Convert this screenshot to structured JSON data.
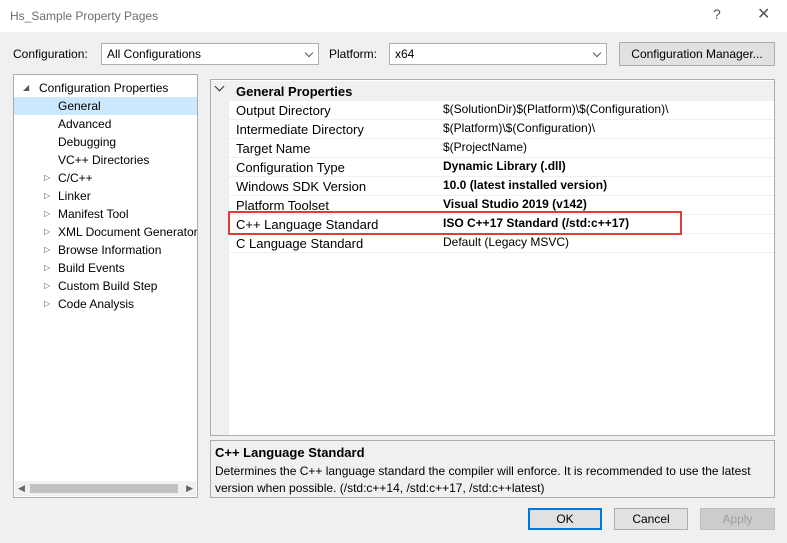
{
  "window": {
    "title": "Hs_Sample Property Pages",
    "help_glyph": "?",
    "close_glyph": "✕"
  },
  "toolbar": {
    "configuration_label": "Configuration:",
    "configuration_value": "All Configurations",
    "platform_label": "Platform:",
    "platform_value": "x64",
    "config_manager_label": "Configuration Manager..."
  },
  "tree": {
    "root_arrow": "◢",
    "collapsed_arrow": "▷",
    "root_label": "Configuration Properties",
    "children": [
      "General",
      "Advanced",
      "Debugging",
      "VC++ Directories"
    ],
    "expandable": [
      "C/C++",
      "Linker",
      "Manifest Tool",
      "XML Document Generator",
      "Browse Information",
      "Build Events",
      "Custom Build Step",
      "Code Analysis"
    ],
    "selected": "General",
    "scroll_left": "◀",
    "scroll_right": "▶"
  },
  "grid": {
    "section_title": "General Properties",
    "properties": [
      {
        "name": "Output Directory",
        "value": "$(SolutionDir)$(Platform)\\$(Configuration)\\",
        "bold": false
      },
      {
        "name": "Intermediate Directory",
        "value": "$(Platform)\\$(Configuration)\\",
        "bold": false
      },
      {
        "name": "Target Name",
        "value": "$(ProjectName)",
        "bold": false
      },
      {
        "name": "Configuration Type",
        "value": "Dynamic Library (.dll)",
        "bold": true
      },
      {
        "name": "Windows SDK Version",
        "value": "10.0 (latest installed version)",
        "bold": true
      },
      {
        "name": "Platform Toolset",
        "value": "Visual Studio 2019 (v142)",
        "bold": true
      },
      {
        "name": "C++ Language Standard",
        "value": "ISO C++17 Standard (/std:c++17)",
        "bold": true
      },
      {
        "name": "C Language Standard",
        "value": "Default (Legacy MSVC)",
        "bold": false
      }
    ],
    "highlight_color": "#e03c3c"
  },
  "description": {
    "title": "C++ Language Standard",
    "body": "Determines the C++ language standard the compiler will enforce. It is recommended to use the latest version when possible.  (/std:c++14, /std:c++17, /std:c++latest)"
  },
  "buttons": {
    "ok": "OK",
    "cancel": "Cancel",
    "apply": "Apply"
  },
  "colors": {
    "selection": "#cce8ff",
    "accent": "#0078d7"
  }
}
